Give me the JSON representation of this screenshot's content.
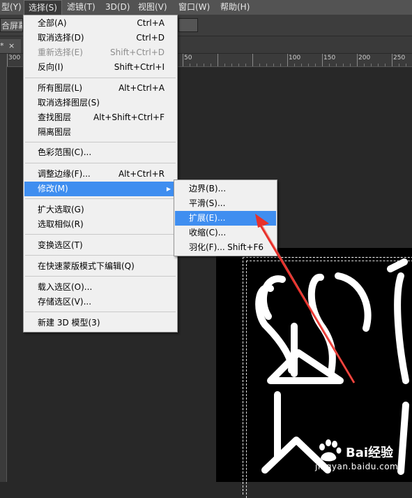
{
  "menubar": {
    "items": [
      {
        "label": "型(Y)"
      },
      {
        "label": "选择(S)"
      },
      {
        "label": "滤镜(T)"
      },
      {
        "label": "3D(D)"
      },
      {
        "label": "视图(V)"
      },
      {
        "label": "窗口(W)"
      },
      {
        "label": "帮助(H)"
      }
    ]
  },
  "options_bar": {
    "mode_button": "合屏幕"
  },
  "document_tab": {
    "dirty_mark": "*",
    "close_glyph": "×"
  },
  "ruler": {
    "labels": [
      "300",
      "50",
      "100",
      "150",
      "200",
      "250"
    ]
  },
  "select_menu": {
    "items": [
      {
        "label": "全部(A)",
        "shortcut": "Ctrl+A"
      },
      {
        "label": "取消选择(D)",
        "shortcut": "Ctrl+D"
      },
      {
        "label": "重新选择(E)",
        "shortcut": "Shift+Ctrl+D"
      },
      {
        "label": "反向(I)",
        "shortcut": "Shift+Ctrl+I"
      },
      {
        "label": "所有图层(L)",
        "shortcut": "Alt+Ctrl+A"
      },
      {
        "label": "取消选择图层(S)",
        "shortcut": ""
      },
      {
        "label": "查找图层",
        "shortcut": "Alt+Shift+Ctrl+F"
      },
      {
        "label": "隔离图层",
        "shortcut": ""
      },
      {
        "label": "色彩范围(C)...",
        "shortcut": ""
      },
      {
        "label": "调整边缘(F)...",
        "shortcut": "Alt+Ctrl+R"
      },
      {
        "label": "修改(M)",
        "shortcut": ""
      },
      {
        "label": "扩大选取(G)",
        "shortcut": ""
      },
      {
        "label": "选取相似(R)",
        "shortcut": ""
      },
      {
        "label": "变换选区(T)",
        "shortcut": ""
      },
      {
        "label": "在快速蒙版模式下编辑(Q)",
        "shortcut": ""
      },
      {
        "label": "载入选区(O)...",
        "shortcut": ""
      },
      {
        "label": "存储选区(V)...",
        "shortcut": ""
      },
      {
        "label": "新建 3D 模型(3)",
        "shortcut": ""
      }
    ]
  },
  "modify_submenu": {
    "items": [
      {
        "label": "边界(B)...",
        "shortcut": ""
      },
      {
        "label": "平滑(S)...",
        "shortcut": ""
      },
      {
        "label": "扩展(E)...",
        "shortcut": ""
      },
      {
        "label": "收缩(C)...",
        "shortcut": ""
      },
      {
        "label": "羽化(F)...",
        "shortcut": "Shift+F6"
      }
    ]
  },
  "watermark": {
    "brand": "Bai",
    "brand2": "经验",
    "url": "jingyan.baidu.com"
  },
  "colors": {
    "highlight": "#3f8ef0",
    "annotation_arrow": "#e8302a",
    "menubar": "#535353",
    "workspace": "#282828"
  }
}
